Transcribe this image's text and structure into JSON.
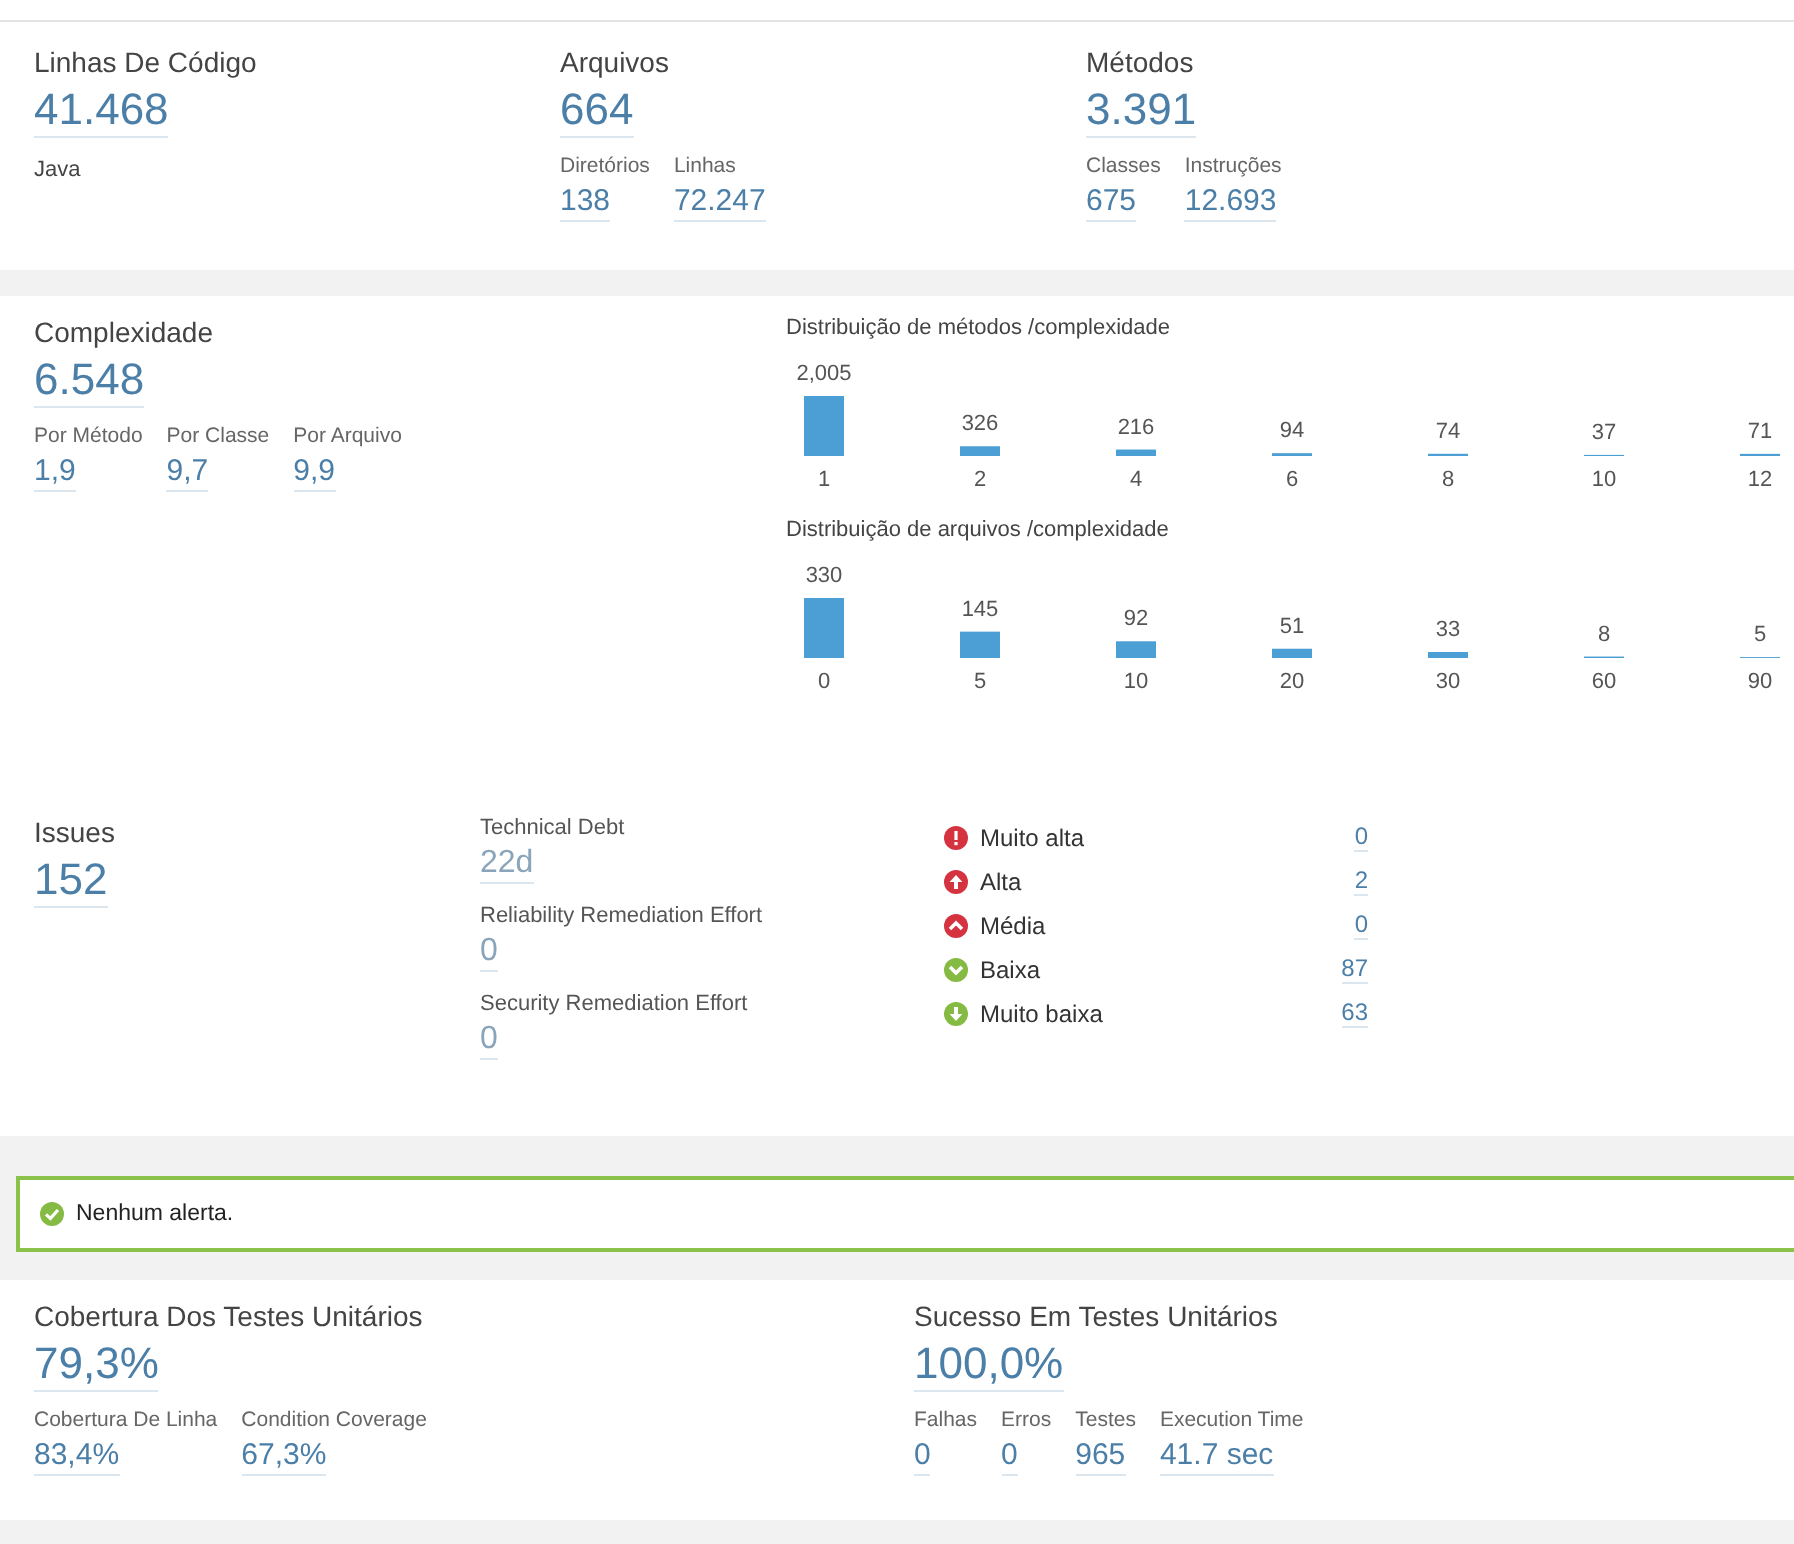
{
  "overview": [
    {
      "label": "Linhas De Código",
      "value": "41.468",
      "note": "Java"
    },
    {
      "label": "Arquivos",
      "value": "664",
      "details": [
        {
          "label": "Diretórios",
          "value": "138"
        },
        {
          "label": "Linhas",
          "value": "72.247"
        }
      ]
    },
    {
      "label": "Métodos",
      "value": "3.391",
      "details": [
        {
          "label": "Classes",
          "value": "675"
        },
        {
          "label": "Instruções",
          "value": "12.693"
        }
      ]
    }
  ],
  "complexity": {
    "label": "Complexidade",
    "value": "6.548",
    "details": [
      {
        "label": "Por Método",
        "value": "1,9"
      },
      {
        "label": "Por Classe",
        "value": "9,7"
      },
      {
        "label": "Por Arquivo",
        "value": "9,9"
      }
    ],
    "distributions": [
      {
        "chart_data": {
          "type": "bar",
          "title": "Distribuição de métodos /complexidade",
          "categories": [
            "1",
            "2",
            "4",
            "6",
            "8",
            "10",
            "12"
          ],
          "values": [
            2005,
            326,
            216,
            94,
            74,
            37,
            71
          ],
          "value_labels": [
            "2,005",
            "326",
            "216",
            "94",
            "74",
            "37",
            "71"
          ]
        }
      },
      {
        "chart_data": {
          "type": "bar",
          "title": "Distribuição de arquivos /complexidade",
          "categories": [
            "0",
            "5",
            "10",
            "20",
            "30",
            "60",
            "90"
          ],
          "values": [
            330,
            145,
            92,
            51,
            33,
            8,
            5
          ],
          "value_labels": [
            "330",
            "145",
            "92",
            "51",
            "33",
            "8",
            "5"
          ]
        }
      }
    ]
  },
  "issues": {
    "label": "Issues",
    "value": "152",
    "efforts": [
      {
        "label": "Technical Debt",
        "value": "22d"
      },
      {
        "label": "Reliability Remediation Effort",
        "value": "0"
      },
      {
        "label": "Security Remediation Effort",
        "value": "0"
      }
    ],
    "severities": [
      {
        "kind": "blocker",
        "label": "Muito alta",
        "count": "0",
        "color": "#d4333f"
      },
      {
        "kind": "critical",
        "label": "Alta",
        "count": "2",
        "color": "#d4333f"
      },
      {
        "kind": "major",
        "label": "Média",
        "count": "0",
        "color": "#d4333f"
      },
      {
        "kind": "minor",
        "label": "Baixa",
        "count": "87",
        "color": "#85bb43"
      },
      {
        "kind": "info",
        "label": "Muito baixa",
        "count": "63",
        "color": "#85bb43"
      }
    ]
  },
  "quality_gate": {
    "kind": "ok",
    "message": "Nenhum alerta."
  },
  "tests": [
    {
      "label": "Cobertura Dos Testes Unitários",
      "value": "79,3%",
      "details": [
        {
          "label": "Cobertura De Linha",
          "value": "83,4%"
        },
        {
          "label": "Condition Coverage",
          "value": "67,3%"
        }
      ]
    },
    {
      "label": "Sucesso Em Testes Unitários",
      "value": "100,0%",
      "details": [
        {
          "label": "Falhas",
          "value": "0"
        },
        {
          "label": "Erros",
          "value": "0"
        },
        {
          "label": "Testes",
          "value": "965"
        },
        {
          "label": "Execution Time",
          "value": "41.7 sec"
        }
      ]
    }
  ]
}
